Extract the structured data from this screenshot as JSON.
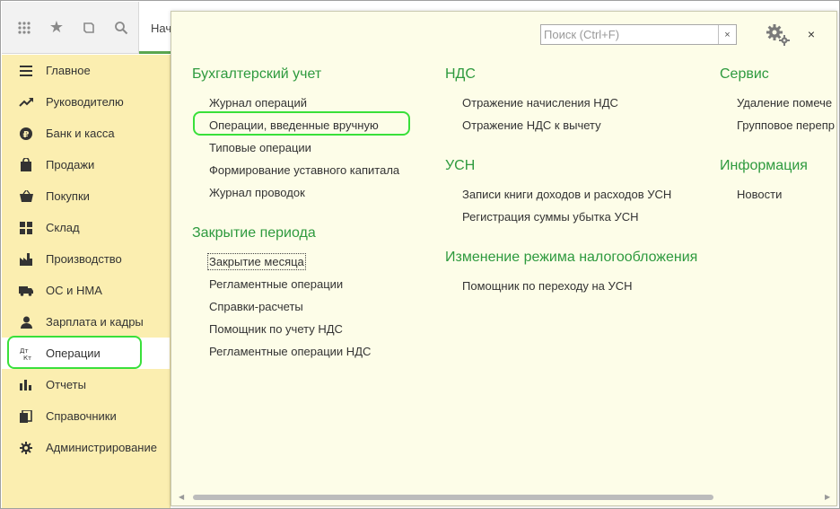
{
  "toolbar": {
    "icons": [
      "apps-grid-icon",
      "favorites-star-icon",
      "history-icon",
      "search-icon"
    ],
    "active_tab_label": "Нач"
  },
  "sidebar": {
    "items": [
      {
        "label": "Главное",
        "icon": "menu-lines-icon"
      },
      {
        "label": "Руководителю",
        "icon": "trend-up-icon"
      },
      {
        "label": "Банк и касса",
        "icon": "ruble-coin-icon"
      },
      {
        "label": "Продажи",
        "icon": "shopping-bag-icon"
      },
      {
        "label": "Покупки",
        "icon": "shopping-basket-icon"
      },
      {
        "label": "Склад",
        "icon": "warehouse-grid-icon"
      },
      {
        "label": "Производство",
        "icon": "factory-icon"
      },
      {
        "label": "ОС и НМА",
        "icon": "truck-icon"
      },
      {
        "label": "Зарплата и кадры",
        "icon": "person-icon"
      },
      {
        "label": "Операции",
        "icon": "dt-kt-icon",
        "icon_text": "Дт Кт"
      },
      {
        "label": "Отчеты",
        "icon": "bar-chart-icon"
      },
      {
        "label": "Справочники",
        "icon": "books-icon"
      },
      {
        "label": "Администрирование",
        "icon": "gear-icon"
      }
    ],
    "active_index": 9
  },
  "panel": {
    "search_placeholder": "Поиск (Ctrl+F)",
    "search_clear": "×",
    "close": "×",
    "sections": {
      "accounting": {
        "title": "Бухгалтерский учет",
        "items": [
          "Журнал операций",
          "Операции, введенные вручную",
          "Типовые операции",
          "Формирование уставного капитала",
          "Журнал проводок"
        ]
      },
      "period_closing": {
        "title": "Закрытие периода",
        "items": [
          "Закрытие месяца",
          "Регламентные операции",
          "Справки-расчеты",
          "Помощник по учету НДС",
          "Регламентные операции НДС"
        ]
      },
      "vat": {
        "title": "НДС",
        "items": [
          "Отражение начисления НДС",
          "Отражение НДС к вычету"
        ]
      },
      "usn": {
        "title": "УСН",
        "items": [
          "Записи книги доходов и расходов УСН",
          "Регистрация суммы убытка УСН"
        ]
      },
      "tax_regime": {
        "title": "Изменение режима налогообложения",
        "items": [
          "Помощник по переходу на УСН"
        ]
      },
      "service": {
        "title": "Сервис",
        "items": [
          "Удаление помече",
          "Групповое перепр"
        ]
      },
      "info": {
        "title": "Информация",
        "items": [
          "Новости"
        ]
      }
    }
  },
  "colors": {
    "section_title": "#2e9a3e",
    "sidebar_bg": "#fbeeb0",
    "panel_bg": "#fdfde8",
    "highlight": "#39e03a"
  }
}
